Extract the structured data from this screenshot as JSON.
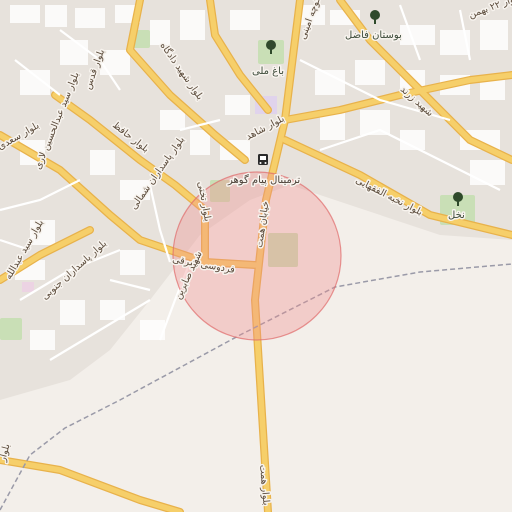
{
  "map": {
    "colors": {
      "background": "#f3efea",
      "urban": "#e7e2dc",
      "block": "#ffffff",
      "major_road": "#f6cf6a",
      "major_road_casing": "#e8b24b",
      "park": "#c9dfb6",
      "highlight_circle": "#f28b8b",
      "boundary": "#9a9aa8"
    },
    "labels": {
      "bahman": "بلوار ۲۲ بهمن",
      "qods": "بلوار قدس",
      "hadi": "بلوار شهید دادگاه",
      "amini": "کوچه امینی",
      "bostan": "بوستان فاضل",
      "abdolhossein": "بلوار سید عبدالحسین لاری",
      "hafez": "بلوار حافظ",
      "bagh": "باغ ملی",
      "takhti": "بلوار تختی",
      "ghods2": "بلوار قدس",
      "shahed": "بلوار شاهد",
      "saad": "بلوار سعدی",
      "pasdaran_n": "بلوار پاسداران شمالی",
      "zarand": "شهید زرند",
      "terminal": "ترمینال پیام گوهر",
      "fatehi": "بلوار نخبه الفقهایی",
      "nakhl": "نخل",
      "abdolkhah": "بلوار سید عبدالله",
      "ferdowsi": "فردوسی شرقی",
      "pasdaran_s": "بلوار پاسداران جنوبی",
      "bahmani": "بلوار بهمن",
      "sabrin": "شهید صابرین",
      "haft": "خیابان همت",
      "haft2": "بلوار همت",
      "bahman_bottom": "بلوار"
    },
    "icons": {
      "bus": "bus-stop-icon",
      "tree": "tree-icon"
    },
    "marker": {
      "type": "radius-circle"
    }
  }
}
